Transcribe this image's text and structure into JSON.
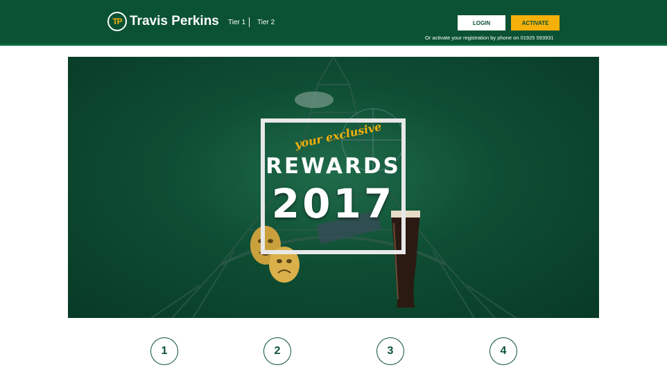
{
  "header": {
    "brand": "Travis Perkins",
    "brand_badge": "TP",
    "nav": [
      "Tier 1",
      "Tier 2"
    ],
    "login_label": "LOGIN",
    "activate_label": "ACTIVATE",
    "phone_note": "Or activate your registration by phone on 01925 593931"
  },
  "hero": {
    "kicker": "your exclusive",
    "title": "REWARDS",
    "year": "2017"
  },
  "steps": [
    "1",
    "2",
    "3",
    "4"
  ],
  "colors": {
    "brand_green": "#0a5233",
    "accent_yellow": "#f5b00a"
  }
}
